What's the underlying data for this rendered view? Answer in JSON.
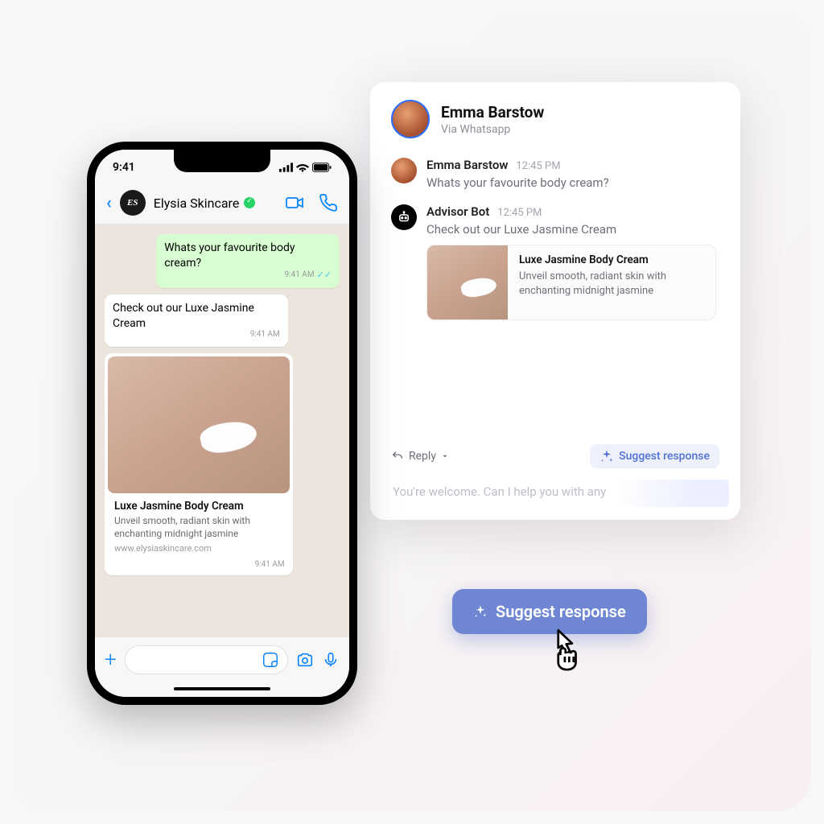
{
  "phone": {
    "status_time": "9:41",
    "header": {
      "contact_name": "Elysia Skincare",
      "avatar_initials": "ES"
    },
    "messages": {
      "outgoing_text": "Whats your favourite body cream?",
      "outgoing_time": "9:41 AM",
      "incoming_text": "Check out our Luxe Jasmine Cream",
      "incoming_time": "9:41 AM"
    },
    "card": {
      "title": "Luxe Jasmine Body Cream",
      "desc": "Unveil smooth, radiant skin with enchanting midnight jasmine",
      "link": "www.elysiaskincare.com",
      "time": "9:41 AM"
    }
  },
  "panel": {
    "customer_name": "Emma Barstow",
    "via": "Via Whatsapp",
    "thread": {
      "user_name": "Emma Barstow",
      "user_time": "12:45 PM",
      "user_text": "Whats your favourite body cream?",
      "bot_name": "Advisor Bot",
      "bot_time": "12:45 PM",
      "bot_text": "Check out our Luxe Jasmine Cream",
      "card_title": "Luxe Jasmine Body Cream",
      "card_desc": "Unveil smooth, radiant skin with enchanting midnight jasmine"
    },
    "reply_label": "Reply",
    "suggest_chip": "Suggest response",
    "compose_placeholder": "You're welcome. Can I help you with any"
  },
  "cta_label": "Suggest response",
  "colors": {
    "accent_blue": "#0a84ff",
    "cta_bg": "#6f87d3",
    "wa_out_bg": "#d8fdd2"
  }
}
